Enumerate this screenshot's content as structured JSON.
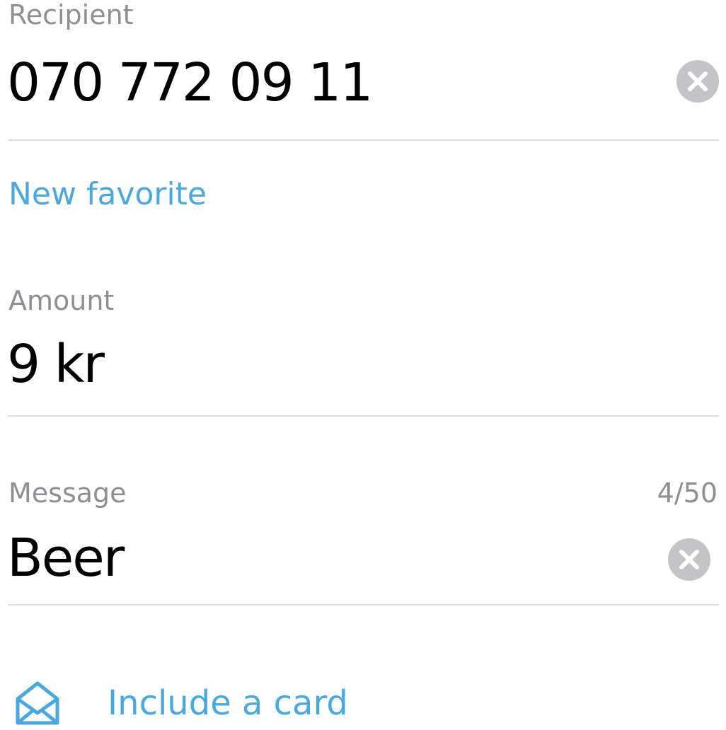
{
  "recipient": {
    "label": "Recipient",
    "value": "070 772 09 11",
    "clear_icon": "clear-circle-icon"
  },
  "favorite": {
    "link_label": "New favorite"
  },
  "amount": {
    "label": "Amount",
    "value": "9 kr"
  },
  "message": {
    "label": "Message",
    "counter": "4/50",
    "value": "Beer",
    "clear_icon": "clear-circle-icon"
  },
  "card": {
    "icon": "envelope-icon",
    "label": "Include a card"
  },
  "colors": {
    "accent": "#4aa8e0",
    "label_gray": "#8e8e93",
    "divider": "#dedede",
    "clear_button": "#c4c4c6"
  }
}
